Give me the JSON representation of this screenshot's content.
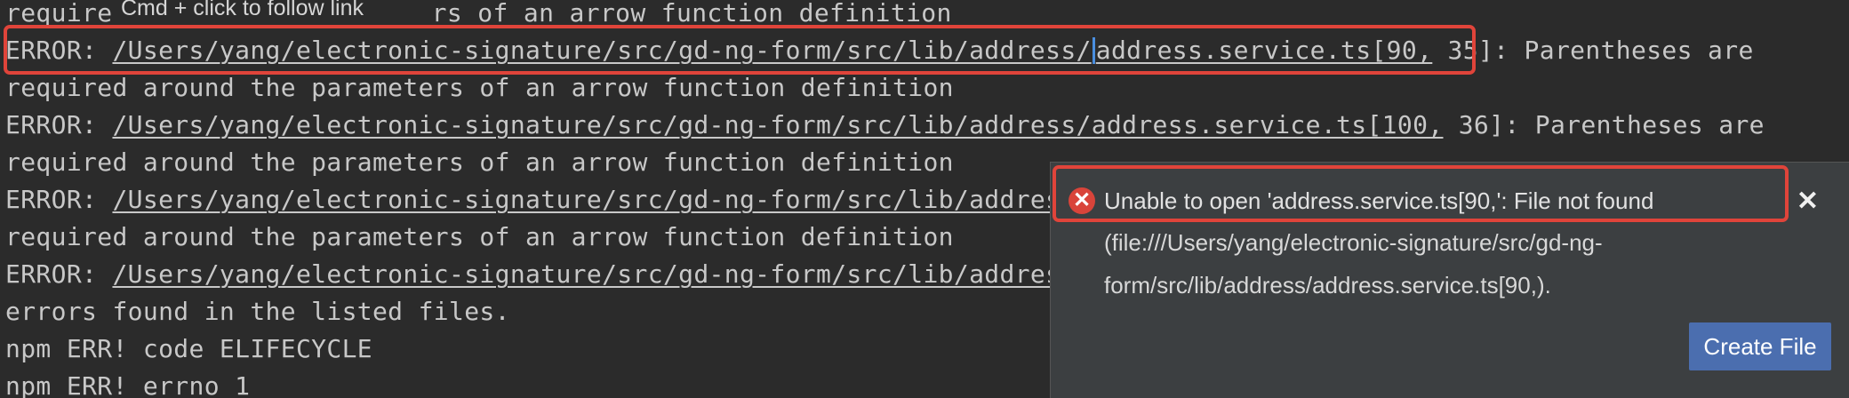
{
  "tooltip": {
    "text": "Cmd + click to follow link"
  },
  "terminal": {
    "line0_prefix": "require ",
    "line0_rest": "rs of an arrow function definition",
    "line1_prefix": "ERROR: ",
    "line1_link_a": "/Users/yang/electronic-signature/src/gd-ng-form/src/lib/address/",
    "line1_link_b": "address.service.ts[90,",
    "line1_rest": " 35]: Parentheses are",
    "line2": "required around the parameters of an arrow function definition",
    "line3_prefix": "ERROR: ",
    "line3_link": "/Users/yang/electronic-signature/src/gd-ng-form/src/lib/address/address.service.ts[100,",
    "line3_rest": " 36]: Parentheses are",
    "line4": "required around the parameters of an arrow function definition",
    "line5_prefix": "ERROR: ",
    "line5_link": "/Users/yang/electronic-signature/src/gd-ng-form/src/lib/address",
    "line6": "required around the parameters of an arrow function definition",
    "line7_prefix": "ERROR: ",
    "line7_link": "/Users/yang/electronic-signature/src/gd-ng-form/src/lib/address",
    "line8": "errors found in the listed files.",
    "line9": "npm ERR! code ELIFECYCLE",
    "line10": "npm ERR! errno 1"
  },
  "notification": {
    "icon": "error-icon",
    "icon_glyph": "✕",
    "title": "Unable to open 'address.service.ts[90,': File not found",
    "body_line1": "(file:///Users/yang/electronic-signature/src/gd-ng-",
    "body_line2": "form/src/lib/address/address.service.ts[90,).",
    "close_glyph": "✕",
    "button_label": "Create File"
  },
  "colors": {
    "background": "#2b2b2b",
    "text": "#c8c8c8",
    "highlight": "#e0443a",
    "notification_bg": "#3c3f41",
    "button": "#4b6eaf",
    "error_icon": "#d9443a"
  }
}
